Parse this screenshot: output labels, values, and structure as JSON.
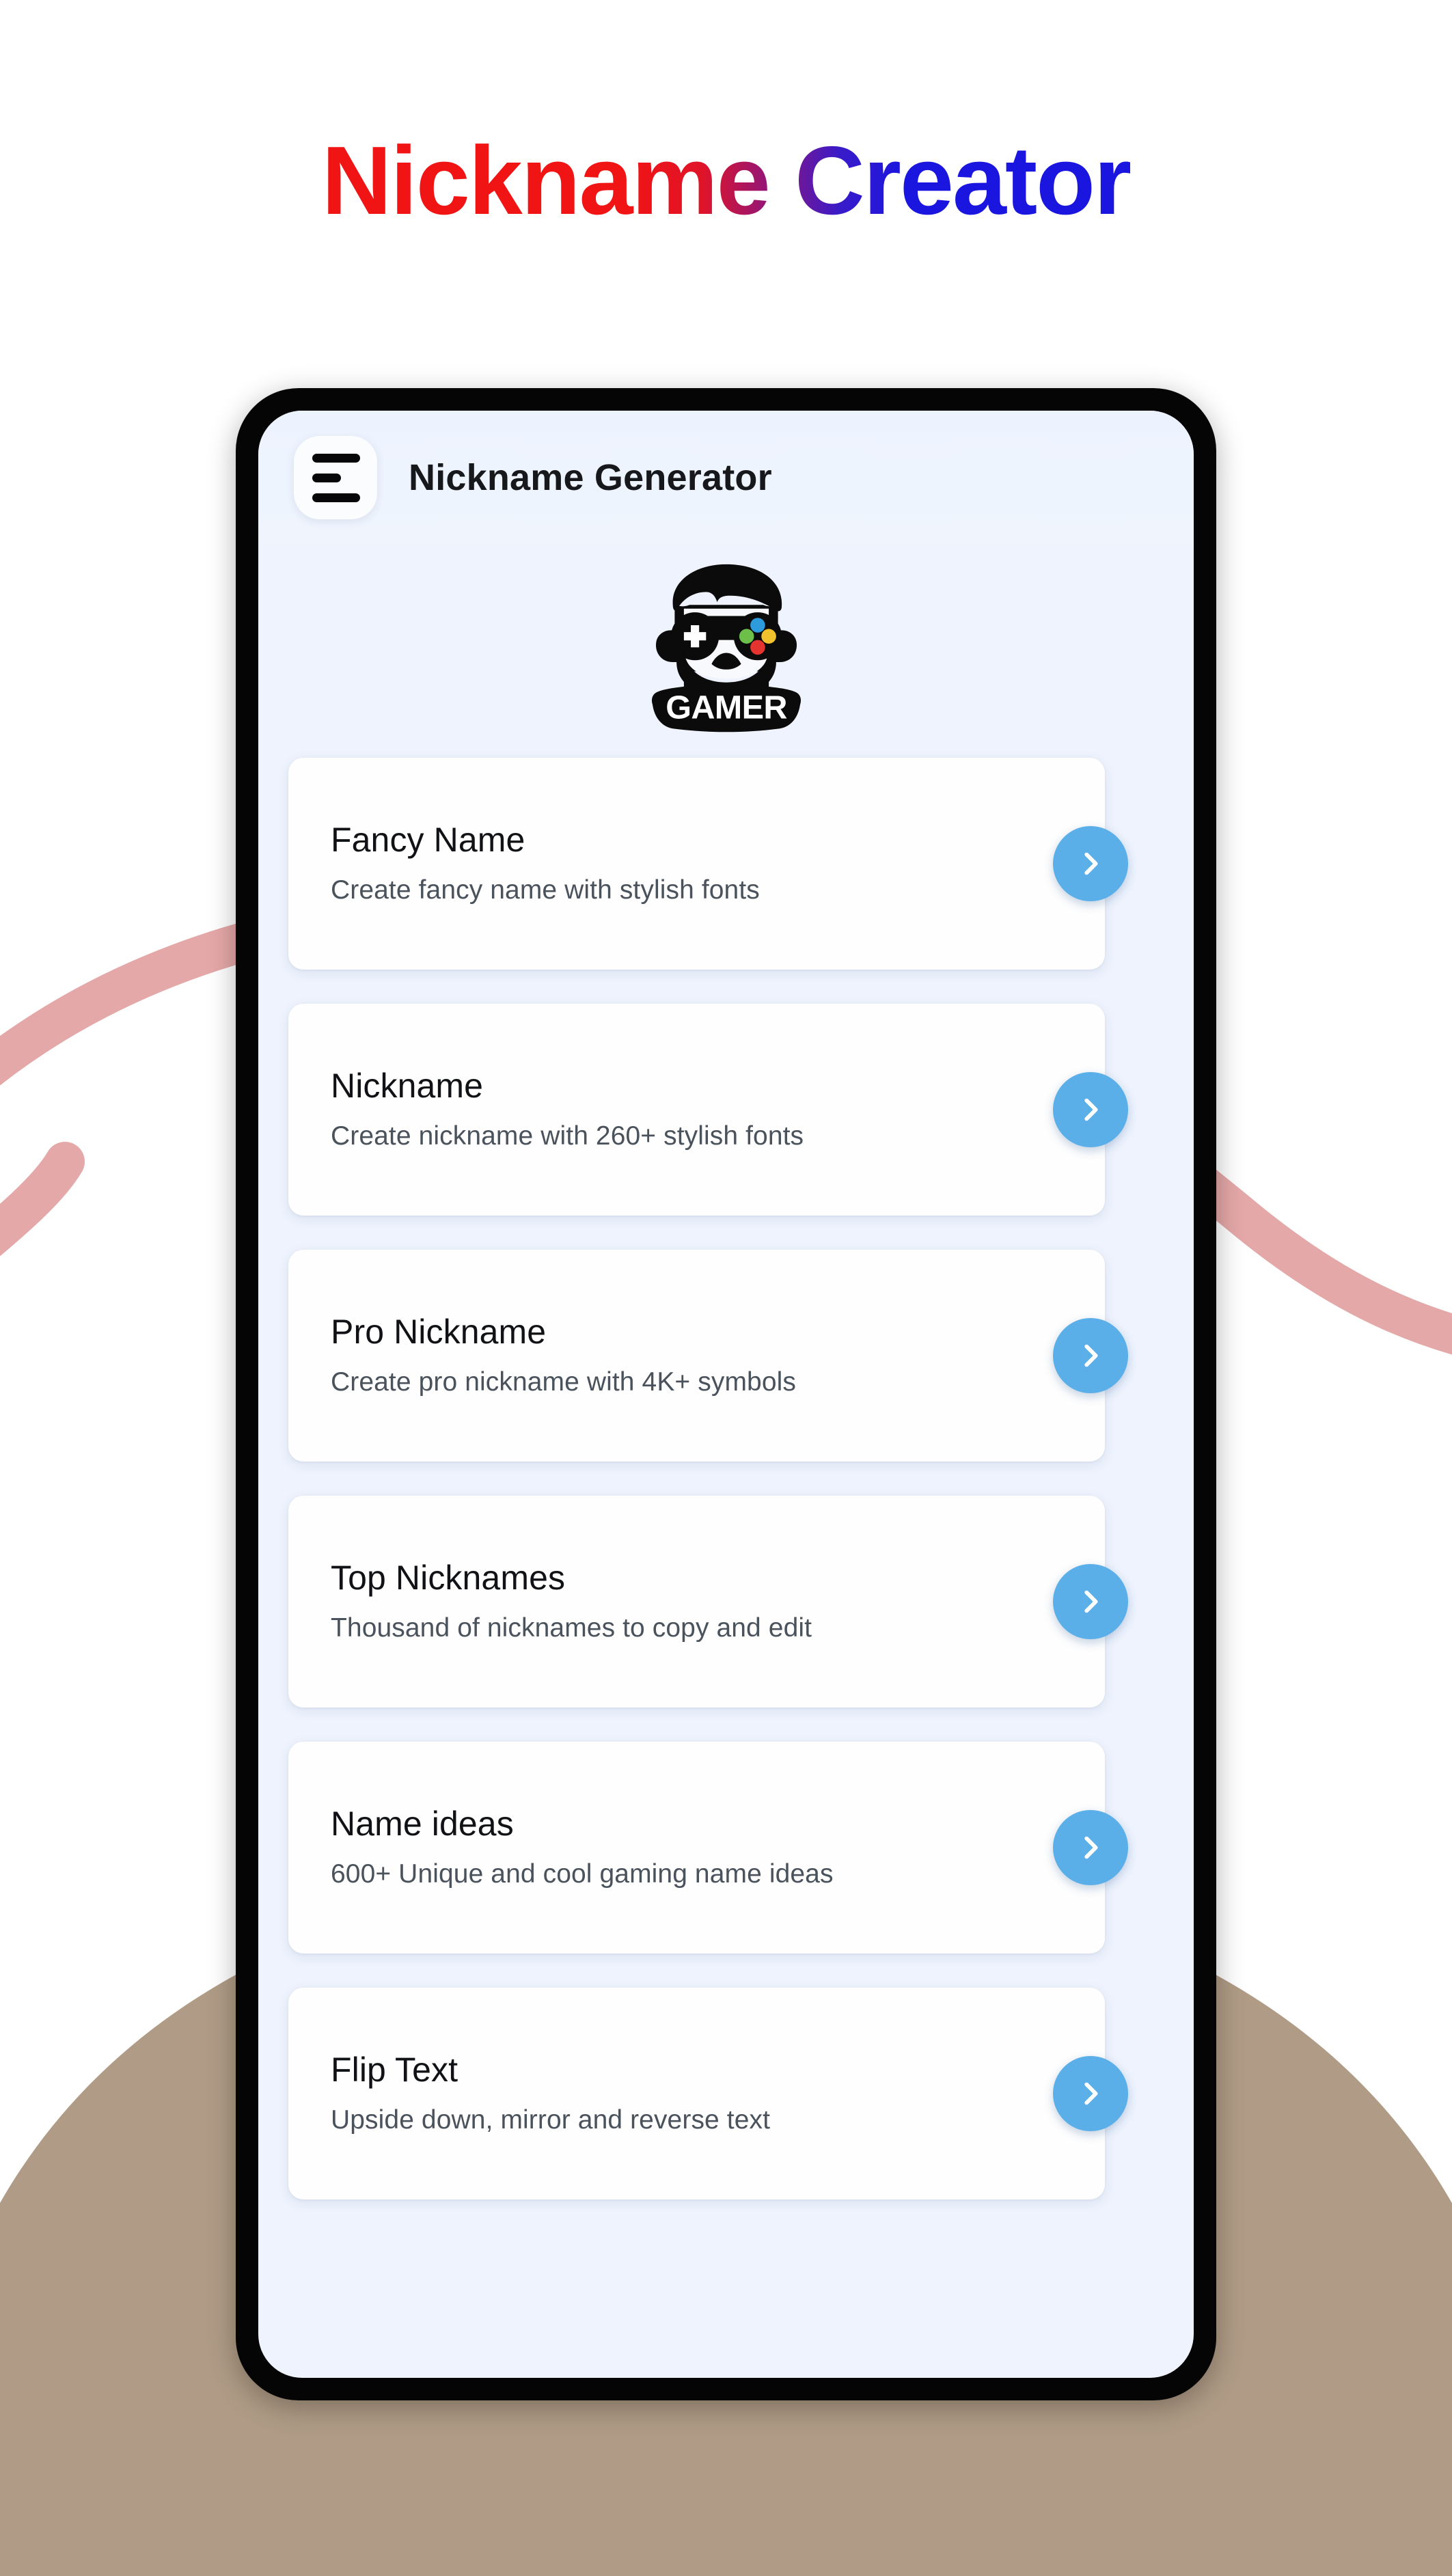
{
  "headline": {
    "title": "Nickname Creator",
    "gradient_from": "#F01414",
    "gradient_to": "#1A16E0"
  },
  "page": {
    "background_color": "#FFFFFF",
    "pink_ribbon_color": "#E5A8A8",
    "tan_hill_color": "#B09C86",
    "phone_frame_color": "#050505",
    "screen_background_color": "#EEF3FD",
    "accent_color": "#5BAFE8"
  },
  "app": {
    "appbar": {
      "menu_icon": "hamburger-menu-icon",
      "title": "Nickname Generator"
    },
    "logo": {
      "name": "gamer-mascot-logo",
      "wordmark": "GAMER",
      "gamepad_button_colors": [
        "#2E9BDC",
        "#F2C12E",
        "#E3342F",
        "#6CC04A"
      ]
    },
    "cards": [
      {
        "title": "Fancy Name",
        "subtitle": "Create fancy name with stylish fonts",
        "arrow_icon": "chevron-right-icon"
      },
      {
        "title": "Nickname",
        "subtitle": "Create nickname with 260+ stylish fonts",
        "arrow_icon": "chevron-right-icon"
      },
      {
        "title": "Pro Nickname",
        "subtitle": "Create pro nickname with 4K+ symbols",
        "arrow_icon": "chevron-right-icon"
      },
      {
        "title": "Top Nicknames",
        "subtitle": "Thousand of nicknames to copy and edit",
        "arrow_icon": "chevron-right-icon"
      },
      {
        "title": "Name ideas",
        "subtitle": "600+ Unique and cool gaming name ideas",
        "arrow_icon": "chevron-right-icon"
      },
      {
        "title": "Flip Text",
        "subtitle": "Upside down, mirror and reverse text",
        "arrow_icon": "chevron-right-icon"
      }
    ]
  }
}
